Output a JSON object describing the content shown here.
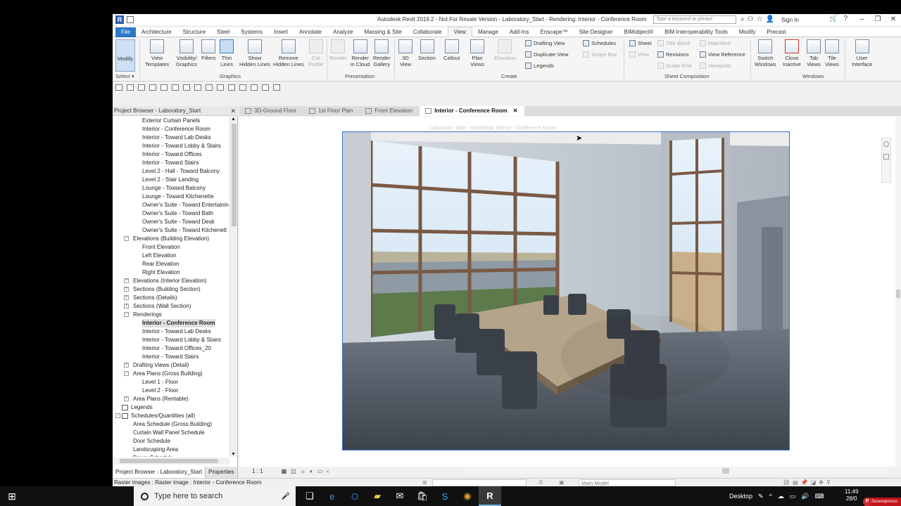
{
  "window": {
    "title": "Autodesk Revit 2019.2 - Not For Resale Version - Laboratory_Start - Rendering: Interior - Conference Room",
    "search_placeholder": "Type a keyword or phrase",
    "signin": "Sign In"
  },
  "ribbon_tabs": [
    "File",
    "Architecture",
    "Structure",
    "Steel",
    "Systems",
    "Insert",
    "Annotate",
    "Analyze",
    "Massing & Site",
    "Collaborate",
    "View",
    "Manage",
    "Add-Ins",
    "Enscape™",
    "Site Designer",
    "BIMobject®",
    "BIM Interoperability Tools",
    "Modify",
    "Precast"
  ],
  "ribbon": {
    "modify": "Modify",
    "select": "Select ▾",
    "view_templates": [
      "View",
      "Templates"
    ],
    "visibility": [
      "Visibility/",
      "Graphics"
    ],
    "filters": "Filters",
    "thin_lines": [
      "Thin",
      "Lines"
    ],
    "show_hidden": [
      "Show",
      "Hidden Lines"
    ],
    "remove_hidden": [
      "Remove",
      "Hidden Lines"
    ],
    "cut_profile": [
      "Cut",
      "Profile"
    ],
    "graphics_label": "Graphics",
    "render": "Render",
    "render_cloud": [
      "Render",
      "in Cloud"
    ],
    "render_gallery": [
      "Render",
      "Gallery"
    ],
    "presentation_label": "Presentation",
    "view_3d": [
      "3D",
      "View"
    ],
    "section": "Section",
    "callout": "Callout",
    "plan_views": [
      "Plan",
      "Views"
    ],
    "elevation": "Elevation",
    "drafting_view": "Drafting View",
    "duplicate_view": "Duplicate View",
    "legends": "Legends",
    "schedules": "Schedules",
    "scope_box": "Scope Box",
    "create_label": "Create",
    "sheet": "Sheet",
    "view": "View",
    "title_block": "Title Block",
    "revisions": "Revisions",
    "guide_grid": "Guide Grid",
    "matchline": "Matchline",
    "view_reference": "View Reference",
    "viewports": "Viewports",
    "sheet_composition_label": "Sheet Composition",
    "switch_windows": [
      "Switch",
      "Windows"
    ],
    "close_inactive": [
      "Close",
      "Inactive"
    ],
    "tab_views": [
      "Tab",
      "Views"
    ],
    "tile_views": [
      "Tile",
      "Views"
    ],
    "windows_label": "Windows",
    "user_interface": [
      "User",
      "Interface"
    ]
  },
  "project_browser": {
    "title": "Project Browser - Laboratory_Start",
    "items": [
      "Exterior Curtain Panels",
      "Interior - Conference Room",
      "Interior - Toward Lab Desks",
      "Interior - Toward Lobby & Stairs",
      "Interior - Toward Offices",
      "Interior - Toward Stairs",
      "Level 2 - Hall - Toward Balcony",
      "Level 2 - Stair Landing",
      "Lounge - Toward Balcony",
      "Lounge - Toward Kitchenette",
      "Owner's Suite - Toward Entertainin",
      "Owner's Suite - Toward Bath",
      "Owner's Suite - Toward Desk",
      "Owner's Suite - Toward Kitchenett",
      "Elevations (Building Elevation)",
      "Front Elevation",
      "Left Elevation",
      "Rear Elevation",
      "Right Elevation",
      "Elevations (Interior Elevation)",
      "Sections (Building Section)",
      "Sections (Details)",
      "Sections (Wall Section)",
      "Renderings",
      "Interior - Conference Room",
      "Interior - Toward Lab Desks",
      "Interior - Toward Lobby & Stairs",
      "Interior - Toward Offices_20",
      "Interior - Toward Stairs",
      "Drafting Views (Detail)",
      "Area Plans (Gross Building)",
      "Level 1 - Floor",
      "Level 2 - Floor",
      "Area Plans (Rentable)",
      "Legends",
      "Schedules/Quantities (all)",
      "Area Schedule (Gross Building)",
      "Curtain Wall Panel Schedule",
      "Door Schedule",
      "Landscaping Area",
      "Room Schedule"
    ],
    "footer_tabs": [
      "Project Browser - Laboratory_Start",
      "Properties"
    ]
  },
  "view_tabs": [
    "3D-Ground Floor",
    "1st Floor Plan",
    "Front Elevation",
    "Interior - Conference Room"
  ],
  "view_control": {
    "scale": "1 : 1"
  },
  "ghost_title": "Laboratory_Start - Rendering: Interior - Conference Room",
  "status": {
    "text": "Raster images : Raster image : Interior - Conference Room",
    "zero": ":0",
    "model": "Main Model"
  },
  "taskbar": {
    "search": "Type here to search",
    "desktop": "Desktop",
    "time": "11:49",
    "date": "28/0",
    "watermark": "Screenpresso"
  }
}
